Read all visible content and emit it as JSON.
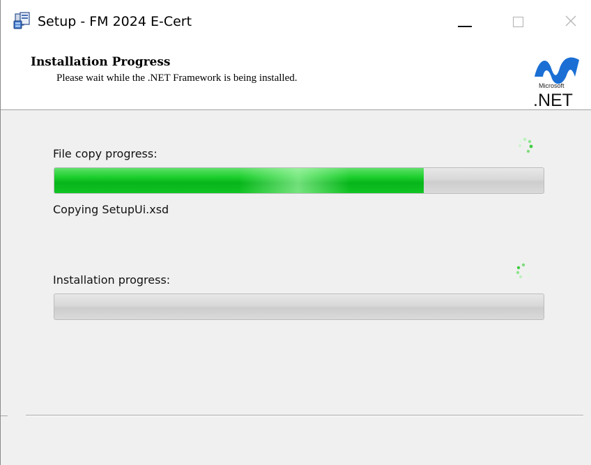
{
  "window": {
    "title": "Setup - FM 2024 E-Cert",
    "icon": "setup-installer-icon"
  },
  "header": {
    "title": "Installation Progress",
    "subtitle": "Please wait while the .NET Framework is being installed.",
    "logo": {
      "brand": "Microsoft",
      "product": ".NET"
    }
  },
  "file_copy": {
    "label": "File copy progress:",
    "progress_fraction": 0.755,
    "status": "Copying SetupUi.xsd",
    "spinner_icon": "loading-spinner-icon"
  },
  "installation": {
    "label": "Installation progress:",
    "progress_fraction": 0,
    "spinner_icon": "loading-spinner-icon"
  },
  "colors": {
    "progress_green": "#06b51a",
    "net_logo_blue": "#1b6fd4",
    "background": "#f0f0f0"
  }
}
